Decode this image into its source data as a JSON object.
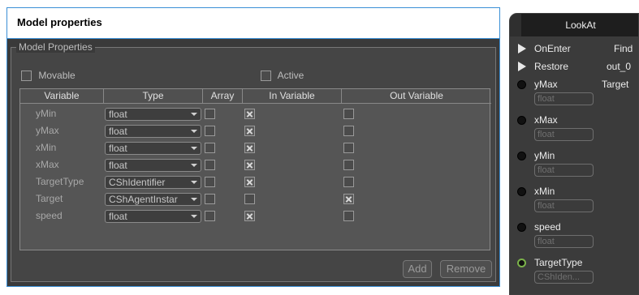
{
  "window": {
    "title": "Model properties",
    "group_title": "Model Properties",
    "movable_label": "Movable",
    "movable_checked": false,
    "active_label": "Active",
    "active_checked": false,
    "columns": [
      "Variable",
      "Type",
      "Array",
      "In Variable",
      "Out Variable"
    ],
    "rows": [
      {
        "variable": "yMin",
        "type": "float",
        "array": false,
        "in": true,
        "out": false
      },
      {
        "variable": "yMax",
        "type": "float",
        "array": false,
        "in": true,
        "out": false
      },
      {
        "variable": "xMin",
        "type": "float",
        "array": false,
        "in": true,
        "out": false
      },
      {
        "variable": "xMax",
        "type": "float",
        "array": false,
        "in": true,
        "out": false
      },
      {
        "variable": "TargetType",
        "type": "CShIdentifier",
        "array": false,
        "in": true,
        "out": false
      },
      {
        "variable": "Target",
        "type": "CShAgentInstar",
        "array": false,
        "in": false,
        "out": true
      },
      {
        "variable": "speed",
        "type": "float",
        "array": false,
        "in": true,
        "out": false
      }
    ],
    "add_label": "Add",
    "remove_label": "Remove"
  },
  "node": {
    "title": "LookAt",
    "exec_inputs": [
      "OnEnter",
      "Restore"
    ],
    "outputs": [
      "Find",
      "out_0",
      "Target"
    ],
    "data_inputs": [
      {
        "label": "yMax",
        "value": "float"
      },
      {
        "label": "xMax",
        "value": "float"
      },
      {
        "label": "yMin",
        "value": "float"
      },
      {
        "label": "xMin",
        "value": "float"
      },
      {
        "label": "speed",
        "value": "float"
      },
      {
        "label": "TargetType",
        "value": "CShIden..."
      }
    ]
  }
}
